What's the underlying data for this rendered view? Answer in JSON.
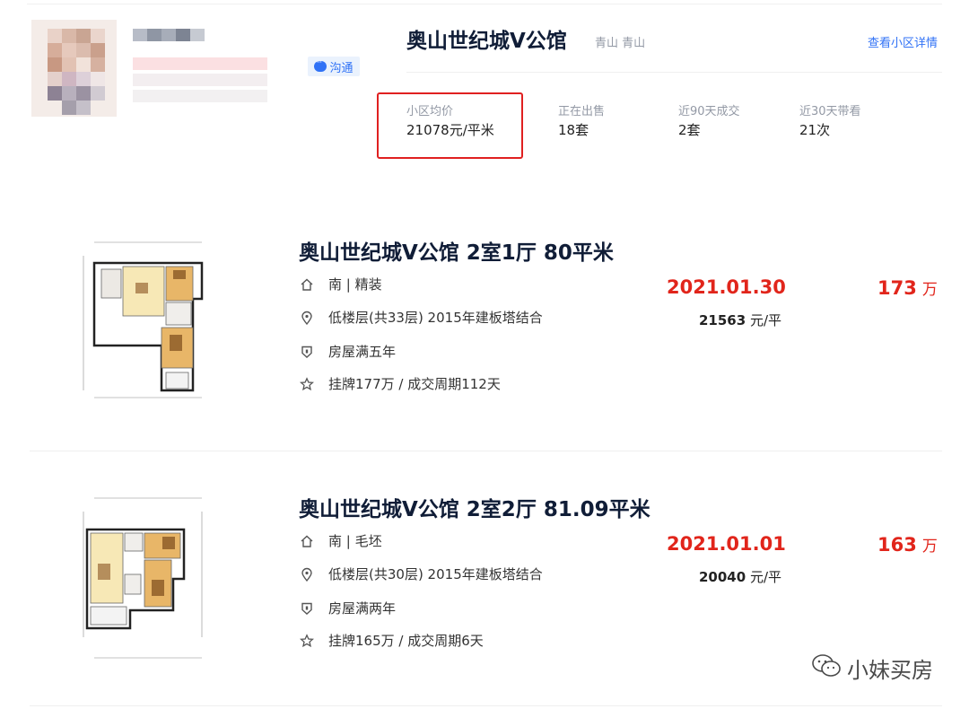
{
  "agent": {
    "chat_label": "沟通"
  },
  "community": {
    "name": "奥山世纪城V公馆",
    "area": "青山 青山",
    "detail_link": "查看小区详情",
    "stats": [
      {
        "label": "小区均价",
        "value": "21078元/平米"
      },
      {
        "label": "正在出售",
        "value": "18套"
      },
      {
        "label": "近90天成交",
        "value": "2套"
      },
      {
        "label": "近30天带看",
        "value": "21次"
      }
    ]
  },
  "listings": [
    {
      "title": "奥山世纪城V公馆 2室1厅 80平米",
      "orientation": "南 | 精装",
      "floor": "低楼层(共33层) 2015年建板塔结合",
      "tenure": "房屋满五年",
      "listing": "挂牌177万 / 成交周期112天",
      "deal_date": "2021.01.30",
      "unit_price_value": "21563",
      "unit_price_unit": "元/平",
      "total_price": "173",
      "total_unit": "万"
    },
    {
      "title": "奥山世纪城V公馆 2室2厅 81.09平米",
      "orientation": "南 | 毛坯",
      "floor": "低楼层(共30层) 2015年建板塔结合",
      "tenure": "房屋满两年",
      "listing": "挂牌165万 / 成交周期6天",
      "deal_date": "2021.01.01",
      "unit_price_value": "20040",
      "unit_price_unit": "元/平",
      "total_price": "163",
      "total_unit": "万"
    }
  ],
  "watermark": {
    "text": "小妹买房"
  },
  "colors": {
    "accent_red": "#e1251b",
    "link_blue": "#3072f6",
    "highlight_border": "#e02020",
    "title_navy": "#101d37"
  }
}
